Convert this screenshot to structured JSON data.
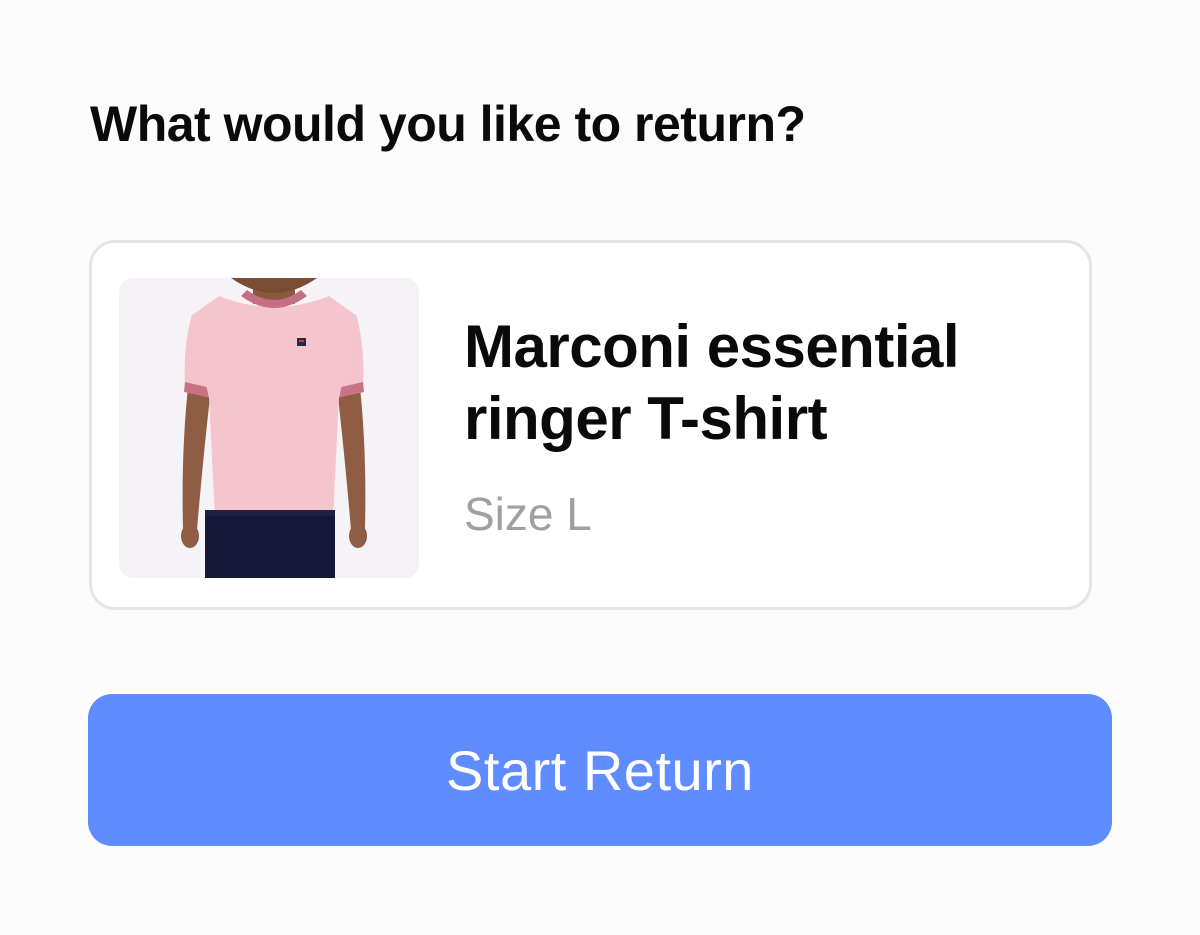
{
  "page": {
    "title": "What would you like to return?"
  },
  "product": {
    "name": "Marconi essential ringer T-shirt",
    "size": "Size L",
    "image_icon": "product-photo-pink-ringer-tshirt"
  },
  "actions": {
    "start_return_label": "Start Return"
  },
  "colors": {
    "background": "#fcfcfc",
    "button": "#5f8dff",
    "button_text": "#ffffff",
    "card_border": "#e5e5e7",
    "muted_text": "#9fa0a4",
    "title_text": "#0a0a0a"
  }
}
